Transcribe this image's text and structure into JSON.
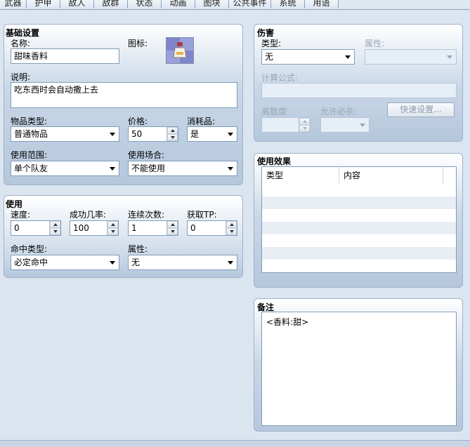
{
  "tabs": [
    "武器",
    "护甲",
    "敌人",
    "敌群",
    "状态",
    "动画",
    "图块",
    "公共事件",
    "系统",
    "用语"
  ],
  "basic": {
    "title": "基础设置",
    "name_label": "名称:",
    "name_value": "甜味香料",
    "icon_label": "图标:",
    "icon_name": "spice-bottle-icon",
    "desc_label": "说明:",
    "desc_value": "吃东西时会自动撒上去",
    "itemtype_label": "物品类型:",
    "itemtype_value": "普通物品",
    "price_label": "价格:",
    "price_value": "50",
    "consumable_label": "消耗品:",
    "consumable_value": "是",
    "scope_label": "使用范围:",
    "scope_value": "单个队友",
    "occasion_label": "使用场合:",
    "occasion_value": "不能使用"
  },
  "usage": {
    "title": "使用",
    "speed_label": "速度:",
    "speed_value": "0",
    "success_label": "成功几率:",
    "success_value": "100",
    "repeat_label": "连续次数:",
    "repeat_value": "1",
    "tp_label": "获取TP:",
    "tp_value": "0",
    "hittype_label": "命中类型:",
    "hittype_value": "必定命中",
    "attr_label": "属性:",
    "attr_value": "无"
  },
  "damage": {
    "title": "伤害",
    "type_label": "类型:",
    "type_value": "无",
    "attr_label": "属性:",
    "formula_label": "计算公式:",
    "variance_label": "离散度:",
    "critical_label": "允许必杀:",
    "quick_button": "快速设置..."
  },
  "effects": {
    "title": "使用效果",
    "col_type": "类型",
    "col_content": "内容"
  },
  "notes": {
    "title": "备注",
    "value": "<香料:甜>"
  }
}
